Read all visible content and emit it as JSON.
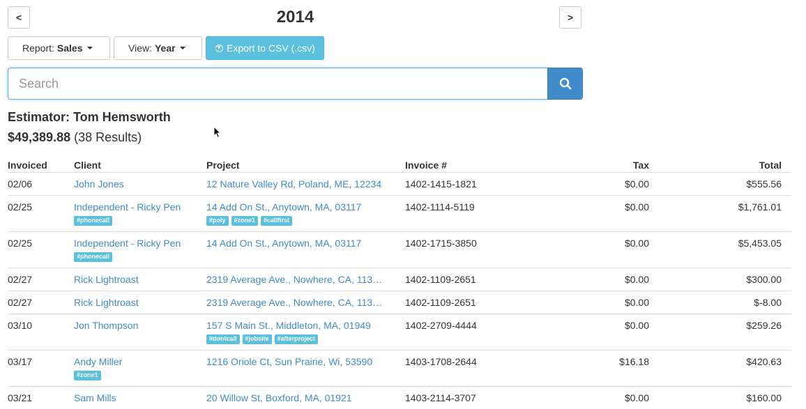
{
  "nav": {
    "prev_label": "<",
    "next_label": ">",
    "year": "2014"
  },
  "toolbar": {
    "report_prefix": "Report:",
    "report_value": "Sales",
    "view_prefix": "View:",
    "view_value": "Year",
    "export_label": "Export to CSV (.csv)"
  },
  "search": {
    "placeholder": "Search",
    "value": ""
  },
  "summary": {
    "estimator": "Estimator: Tom Hemsworth",
    "total": "$49,389.88",
    "results": "(38 Results)"
  },
  "colors": {
    "link": "#428bca",
    "tag": "#5bc0de",
    "primary": "#428bca"
  },
  "table": {
    "headers": [
      "Invoiced",
      "Client",
      "Project",
      "Invoice #",
      "Tax",
      "Total"
    ],
    "rows": [
      {
        "date": "02/06",
        "client": "John Jones",
        "client_tags": [],
        "project": "12 Nature Valley Rd, Poland, ME, 12234",
        "project_tags": [],
        "invoice": "1402-1415-1821",
        "tax": "$0.00",
        "total": "$555.56"
      },
      {
        "date": "02/25",
        "client": "Independent - Ricky Pen",
        "client_tags": [
          "#phonecall"
        ],
        "project": "14 Add On St., Anytown, MA, 03117",
        "project_tags": [
          "#poly",
          "#zone1",
          "#callfirst"
        ],
        "invoice": "1402-1114-5119",
        "tax": "$0.00",
        "total": "$1,761.01"
      },
      {
        "date": "02/25",
        "client": "Independent - Ricky Pen",
        "client_tags": [
          "#phonecall"
        ],
        "project": "14 Add On St., Anytown, MA, 03117",
        "project_tags": [],
        "invoice": "1402-1715-3850",
        "tax": "$0.00",
        "total": "$5,453.05"
      },
      {
        "date": "02/27",
        "client": "Rick Lightroast",
        "client_tags": [],
        "project": "2319 Average Ave., Nowhere, CA, 113…",
        "project_tags": [],
        "invoice": "1402-1109-2651",
        "tax": "$0.00",
        "total": "$300.00"
      },
      {
        "date": "02/27",
        "client": "Rick Lightroast",
        "client_tags": [],
        "project": "2319 Average Ave., Nowhere, CA, 113…",
        "project_tags": [],
        "invoice": "1402-1109-2651",
        "tax": "$0.00",
        "total": "$-8.00"
      },
      {
        "date": "03/10",
        "client": "Jon Thompson",
        "client_tags": [],
        "project": "157 S Main St., Middleton, MA, 01949",
        "project_tags": [
          "#dontcall",
          "#jobsite",
          "#afterproject"
        ],
        "invoice": "1402-2709-4444",
        "tax": "$0.00",
        "total": "$259.26"
      },
      {
        "date": "03/17",
        "client": "Andy Miller",
        "client_tags": [
          "#zone1"
        ],
        "project": "1216 Oriole Ct, Sun Prairie, Wi, 53590",
        "project_tags": [],
        "invoice": "1403-1708-2644",
        "tax": "$16.18",
        "total": "$420.63"
      },
      {
        "date": "03/21",
        "client": "Sam Mills",
        "client_tags": [],
        "project": "20 Willow St, Boxford, MA, 01921",
        "project_tags": [],
        "invoice": "1403-2114-3707",
        "tax": "$0.00",
        "total": "$160.00"
      }
    ]
  }
}
